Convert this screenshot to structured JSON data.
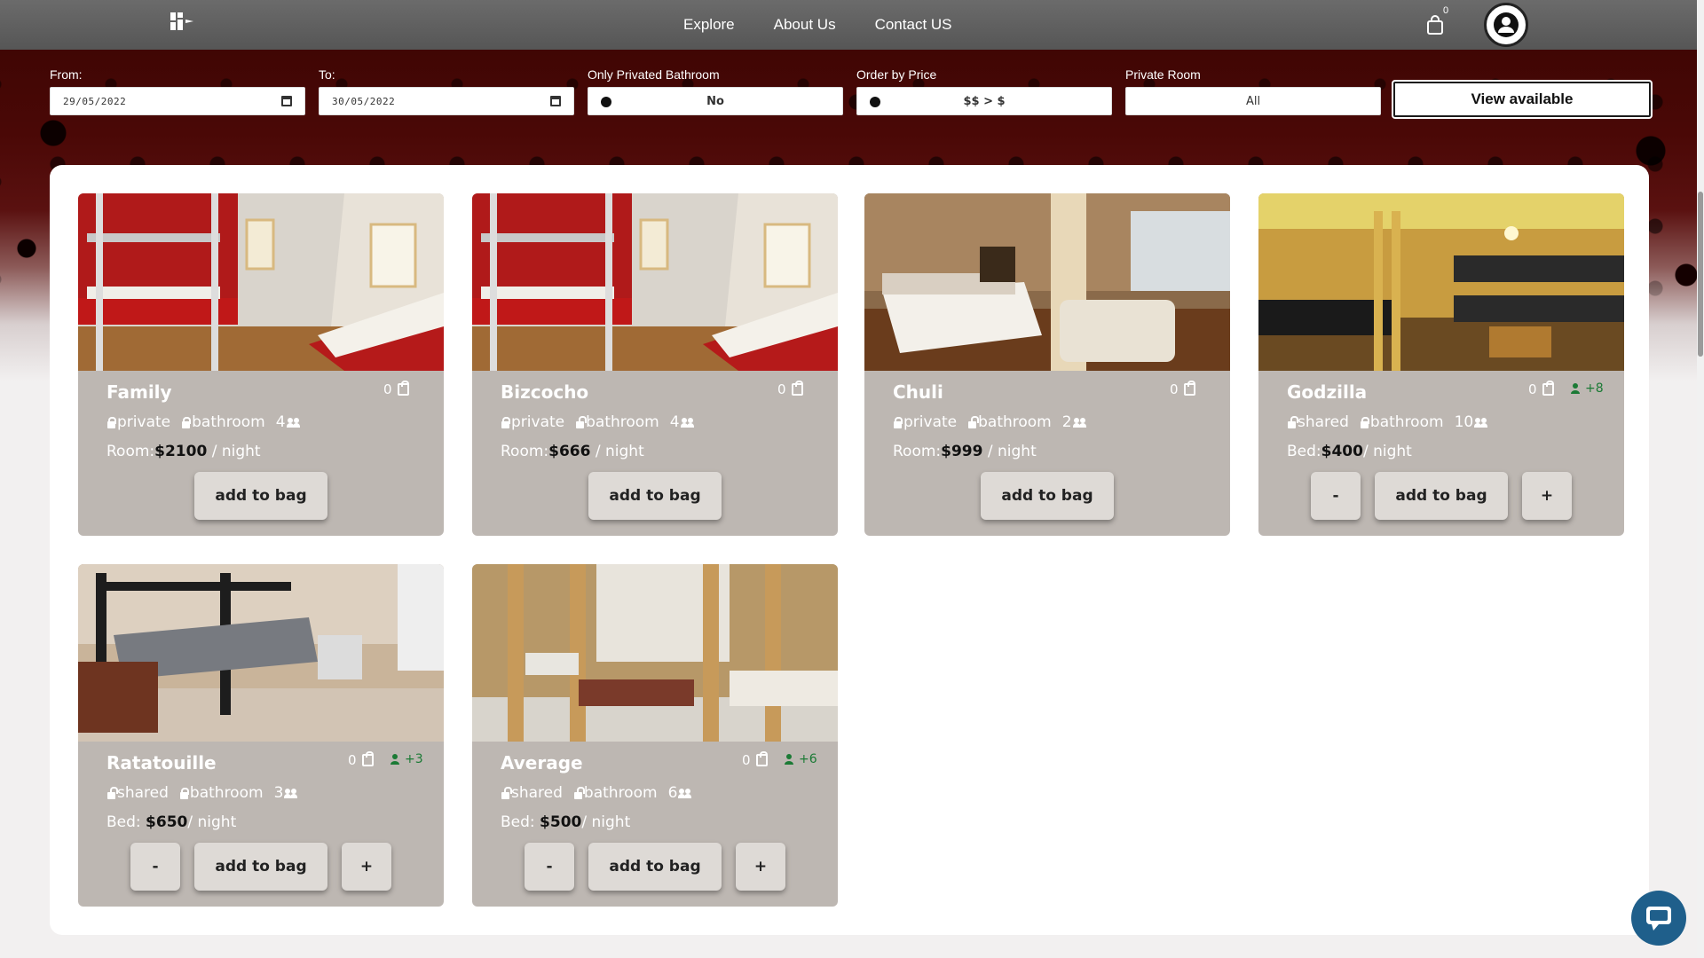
{
  "nav": {
    "links": [
      "Explore",
      "About Us",
      "Contact US"
    ],
    "cart_count": "0"
  },
  "filters": {
    "from_label": "From:",
    "from_value": "29/05/2022",
    "to_label": "To:",
    "to_value": "30/05/2022",
    "bathroom_label": "Only Privated Bathroom",
    "bathroom_value": "No",
    "price_label": "Order by Price",
    "price_value": "$$ > $",
    "room_label": "Private Room",
    "room_value": "All",
    "view_button": "View available"
  },
  "labels": {
    "add_to_bag": "add to bag",
    "minus": "-",
    "plus": "+",
    "night": "/ night",
    "bathroom": "bathroom"
  },
  "rooms": [
    {
      "name": "Family",
      "stock": "0",
      "privacy": "private",
      "capacity": "4",
      "price_label": "Room:",
      "price": "$2100",
      "extra": ""
    },
    {
      "name": "Bizcocho",
      "stock": "0",
      "privacy": "private",
      "capacity": "4",
      "price_label": "Room:",
      "price": "$666",
      "extra": ""
    },
    {
      "name": "Chuli",
      "stock": "0",
      "privacy": "private",
      "capacity": "2",
      "price_label": "Room:",
      "price": "$999",
      "extra": ""
    },
    {
      "name": "Godzilla",
      "stock": "0",
      "privacy": "shared",
      "capacity": "10",
      "price_label": "Bed:",
      "price": "$400",
      "extra": "+8"
    },
    {
      "name": "Ratatouille",
      "stock": "0",
      "privacy": "shared",
      "capacity": "3",
      "price_label": "Bed:",
      "price": "$650",
      "extra": "+3"
    },
    {
      "name": "Average",
      "stock": "0",
      "privacy": "shared",
      "capacity": "6",
      "price_label": "Bed:",
      "price": "$500",
      "extra": "+6"
    }
  ],
  "colors": {
    "card_bg": "#bdb7b2",
    "hero": "#4a0806",
    "extra_green": "#1b7a35",
    "chat": "#1f5f8b"
  }
}
